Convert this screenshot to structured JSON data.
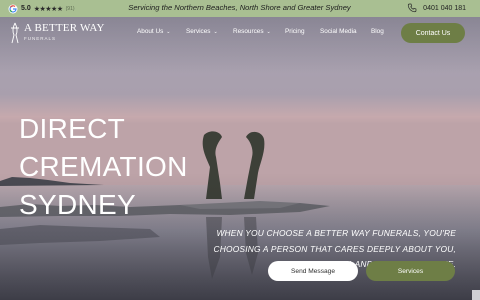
{
  "topbar": {
    "rating_score": "5.0",
    "stars": "★★★★★",
    "reviews": "(91)",
    "tagline": "Servicing the Northern Beaches, North Shore and Greater Sydney",
    "phone": "0401 040 181",
    "icons": {
      "google": "google-g-icon",
      "phone": "phone-icon"
    }
  },
  "header": {
    "logo_name": "A BETTER WAY",
    "logo_sub": "FUNERALS",
    "nav": [
      {
        "label": "About Us",
        "has_dropdown": true
      },
      {
        "label": "Services",
        "has_dropdown": true
      },
      {
        "label": "Resources",
        "has_dropdown": true
      },
      {
        "label": "Pricing",
        "has_dropdown": false
      },
      {
        "label": "Social Media",
        "has_dropdown": false
      },
      {
        "label": "Blog",
        "has_dropdown": false
      }
    ],
    "dropdown_glyph": "⌄",
    "contact_label": "Contact Us"
  },
  "hero": {
    "title_line1": "DIRECT CREMATION",
    "title_line2": "SYDNEY",
    "copy_line1": "WHEN YOU CHOOSE A BETTER WAY FUNERALS, YOU'RE",
    "copy_line2": "CHOOSING A PERSON THAT CARES DEEPLY ABOUT YOU,",
    "copy_line3": "YOUR FAMILY, AND YOUR LOVED ONE.",
    "send_label": "Send Message",
    "services_label": "Services"
  },
  "colors": {
    "topbar_bg": "#a9bf92",
    "brand_green": "#6e7e46",
    "white": "#ffffff"
  }
}
